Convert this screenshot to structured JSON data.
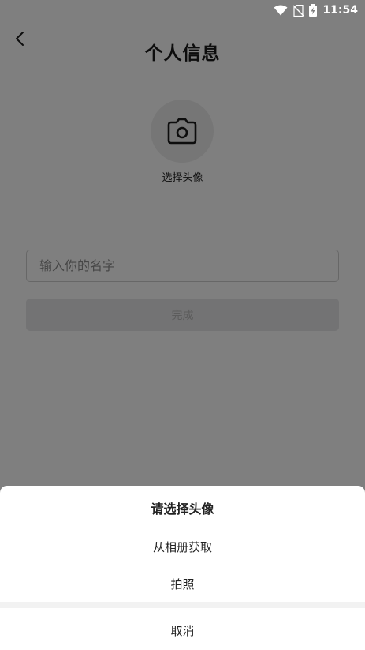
{
  "status_bar": {
    "time": "11:54",
    "icons": [
      "wifi-icon",
      "no-sim-icon",
      "battery-charging-icon"
    ]
  },
  "header": {
    "back_icon": "chevron-left-icon",
    "title": "个人信息"
  },
  "avatar": {
    "icon": "camera-icon",
    "label": "选择头像"
  },
  "form": {
    "name_placeholder": "输入你的名字",
    "name_value": "",
    "done_label": "完成"
  },
  "sheet": {
    "title": "请选择头像",
    "options": [
      {
        "label": "从相册获取"
      },
      {
        "label": "拍照"
      }
    ],
    "cancel_label": "取消"
  },
  "colors": {
    "overlay": "#000000",
    "input_border": "#cfcfcf",
    "button_disabled_bg": "#e6e6e8",
    "button_disabled_text": "#b8b8b8",
    "avatar_bg": "#ececec"
  }
}
